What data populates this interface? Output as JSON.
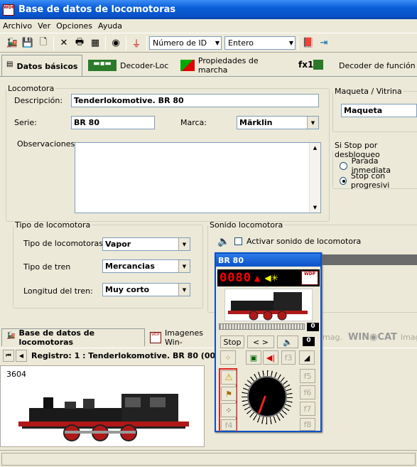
{
  "window": {
    "title": "Base de datos de locomotoras"
  },
  "menu": [
    "Archivo",
    "Ver",
    "Opciones",
    "Ayuda"
  ],
  "toolbar": {
    "sort_field": "Número de ID",
    "sort_mode": "Entero"
  },
  "tabs": [
    "Datos básicos",
    "Decoder-Loc",
    "Propiedades de marcha",
    "Decoder de función"
  ],
  "locomotora": {
    "legend": "Locomotora",
    "descripcion_label": "Descripción:",
    "descripcion": "Tenderlokomotive. BR 80",
    "serie_label": "Serie:",
    "serie": "BR 80",
    "marca_label": "Marca:",
    "marca": "Märklin",
    "observaciones_label": "Observaciones:",
    "observaciones": ""
  },
  "maqueta": {
    "legend": "Maqueta / Vitrina",
    "value": "Maqueta"
  },
  "stop": {
    "legend": "Si Stop por desbloqueo",
    "options": [
      "Parada inmediata",
      "Stop con progresivi"
    ],
    "selected": 1
  },
  "tipo": {
    "legend": "Tipo de locomotora",
    "tipo_label": "Tipo de locomotoras:",
    "tipo": "Vapor",
    "tren_label": "Tipo de tren",
    "tren": "Mercancias",
    "longitud_label": "Longitud del tren:",
    "longitud": "Muy corto"
  },
  "sonido": {
    "legend": "Sonido locomotora",
    "checkbox_label": "Activar sonido de locomotora",
    "checked": false
  },
  "bottom_tabs": [
    "Base de datos de locomotoras",
    "Imagenes Win-",
    "mag.",
    "Imag."
  ],
  "navbar": {
    "record": "Registro: 1 : Tenderlokomotive. BR 80  (0080"
  },
  "photo": {
    "id": "3604"
  },
  "throttle": {
    "title": "BR 80",
    "address": "0080",
    "speed_value": "0",
    "stop_label": "Stop",
    "dir_label": "< >",
    "f_value": "0",
    "function_labels": [
      "f3",
      "f4",
      "f5",
      "f6",
      "f7",
      "f8"
    ]
  }
}
